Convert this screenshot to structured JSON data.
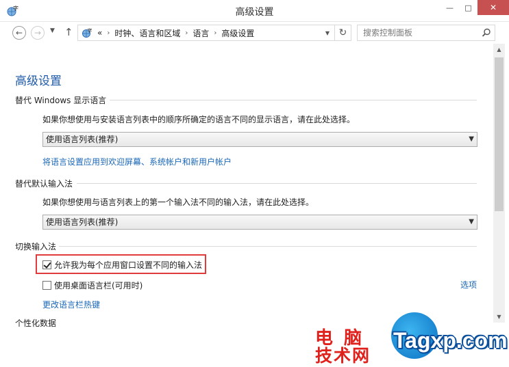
{
  "window": {
    "title": "高级设置",
    "minimize_glyph": "—",
    "maximize_glyph": "□",
    "close_glyph": "✕"
  },
  "nav": {
    "back_glyph": "←",
    "forward_glyph": "→",
    "recent_glyph": "▼",
    "up_glyph": "↑",
    "overflow": "«",
    "breadcrumbs": [
      "时钟、语言和区域",
      "语言",
      "高级设置"
    ],
    "refresh_glyph": "↻",
    "search_placeholder": "搜索控制面板"
  },
  "content": {
    "page_title": "高级设置",
    "sections": {
      "display_language": {
        "title": "替代 Windows 显示语言",
        "description": "如果你想使用与安装语言列表中的顺序所确定的语言不同的显示语言，请在此处选择。",
        "select_value": "使用语言列表(推荐)",
        "link": "将语言设置应用到欢迎屏幕、系统帐户和新用户帐户"
      },
      "default_input": {
        "title": "替代默认输入法",
        "description": "如果你想使用与语言列表上的第一个输入法不同的输入法，请在此处选择。",
        "select_value": "使用语言列表(推荐)"
      },
      "switch_input": {
        "title": "切换输入法",
        "per_app_label": "允许我为每个应用窗口设置不同的输入法",
        "per_app_checked": true,
        "desktop_bar_label": "使用桌面语言栏(可用时)",
        "desktop_bar_checked": false,
        "options_link": "选项",
        "hotkeys_link": "更改语言栏热键"
      },
      "personalization": {
        "title": "个性化数据"
      }
    }
  },
  "watermark": {
    "line1": "电脑",
    "line2": "技术网",
    "brand": "Tagxp.com"
  },
  "colors": {
    "accent_title": "#1e5aa8",
    "link": "#1a67b8",
    "close_button": "#c75050",
    "highlight_box": "#e03a3a",
    "watermark_red": "#e0201a",
    "watermark_blue": "#0a6fc2"
  }
}
